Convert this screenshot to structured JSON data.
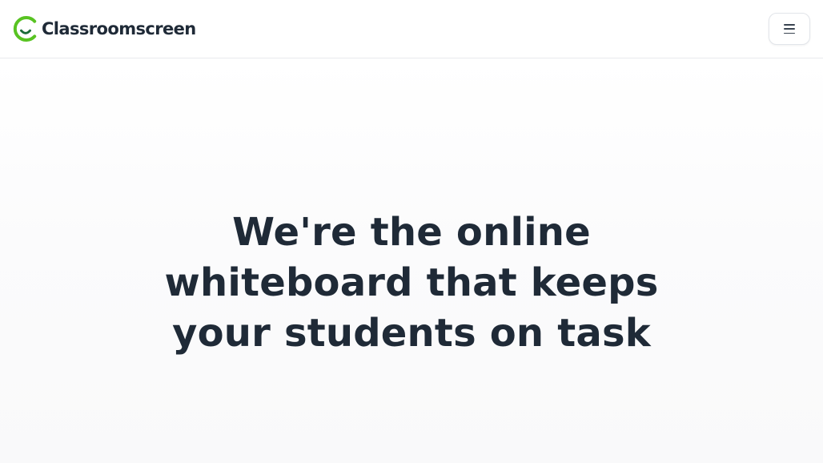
{
  "brand": {
    "name": "Classroomscreen",
    "logo_icon": "classroomscreen-smile-logo-icon",
    "colors": {
      "logo_green": "#58c322",
      "logo_dark_green": "#1c6b3a",
      "text_dark": "#1f2a37"
    }
  },
  "header": {
    "menu_icon": "hamburger-menu-icon"
  },
  "hero": {
    "title_lines": [
      "We're the online",
      "whiteboard that keeps",
      "your students on task"
    ]
  }
}
